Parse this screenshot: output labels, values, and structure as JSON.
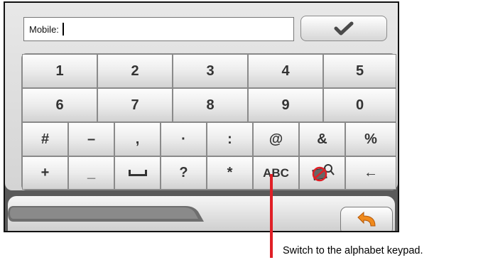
{
  "input": {
    "label": "Mobile:",
    "value": ""
  },
  "ok_button": {
    "icon": "checkmark-icon"
  },
  "keypad": {
    "row1": [
      "1",
      "2",
      "3",
      "4",
      "5"
    ],
    "row2": [
      "6",
      "7",
      "8",
      "9",
      "0"
    ],
    "row3": [
      "#",
      "–",
      ",",
      "·",
      ":",
      "@",
      "&",
      "%"
    ],
    "row4": [
      "+",
      "_",
      "␣",
      "?",
      "*",
      "ABC",
      "map-icon",
      "←"
    ]
  },
  "back_button": {
    "icon": "return-arrow-icon"
  },
  "caption": "Switch to the alphabet keypad.",
  "colors": {
    "callout": "#e01f26",
    "back_arrow": "#f08a1c"
  }
}
